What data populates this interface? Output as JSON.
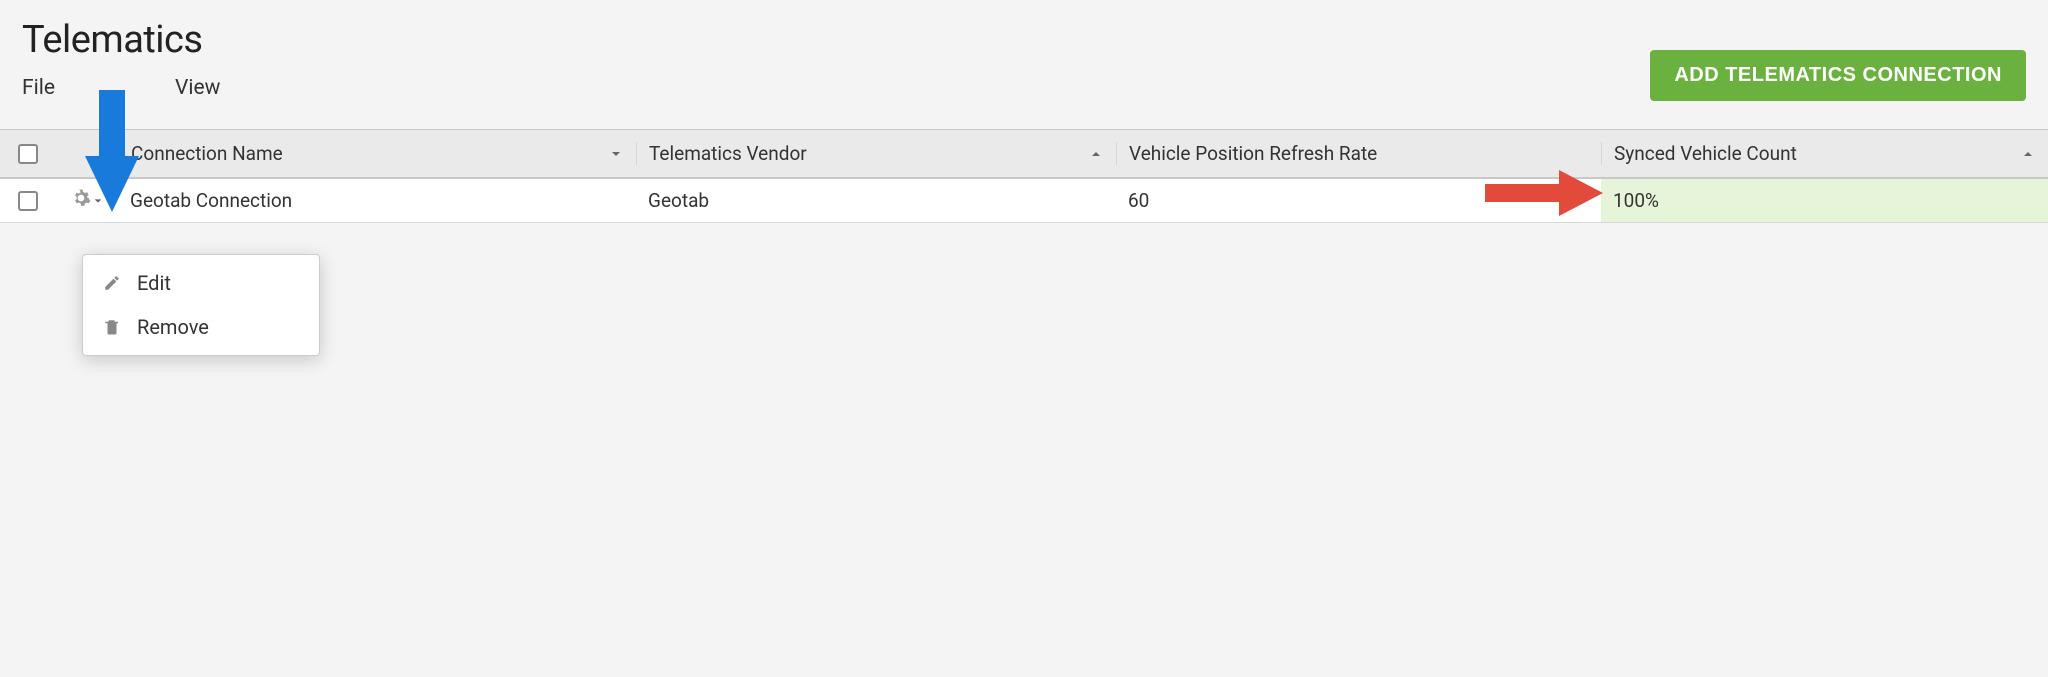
{
  "page": {
    "title": "Telematics",
    "menu": {
      "file": "File",
      "view": "View"
    },
    "add_button": "ADD TELEMATICS CONNECTION"
  },
  "columns": {
    "connection_name": "Connection Name",
    "telematics_vendor": "Telematics Vendor",
    "refresh_rate": "Vehicle Position Refresh Rate",
    "synced_count": "Synced Vehicle Count"
  },
  "rows": [
    {
      "name": "Geotab Connection",
      "vendor": "Geotab",
      "rate": "60",
      "synced": "100%"
    }
  ],
  "context_menu": {
    "edit": "Edit",
    "remove": "Remove"
  }
}
